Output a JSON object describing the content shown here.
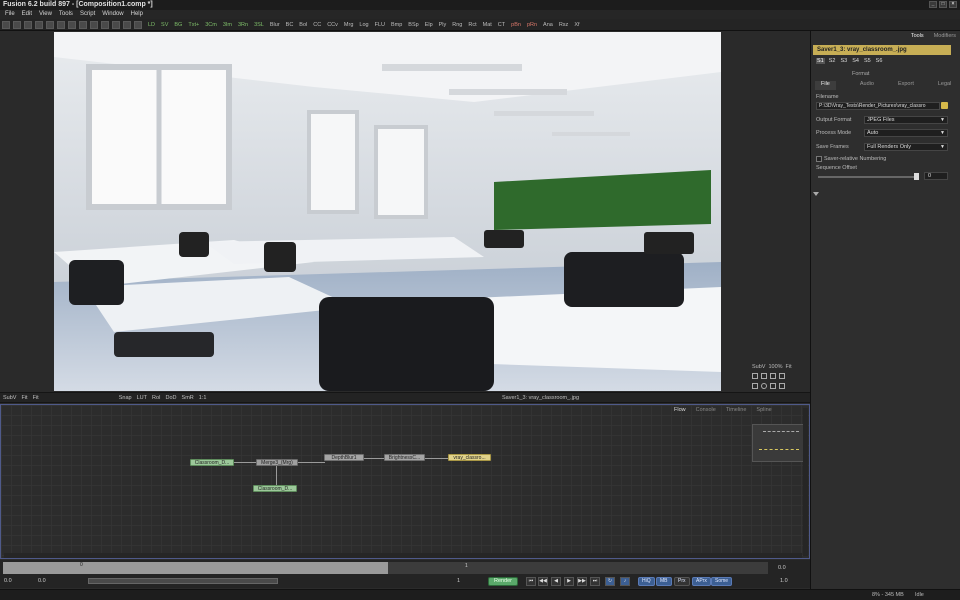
{
  "window": {
    "title": "Fusion 6.2 build 897 - [Composition1.comp *]"
  },
  "menu": [
    "File",
    "Edit",
    "View",
    "Tools",
    "Script",
    "Window",
    "Help"
  ],
  "toolbar": {
    "tools": [
      "LD",
      "SV",
      "BG",
      "Txt+",
      "3Cm",
      "3Im",
      "3Rn",
      "3SL",
      "Blur",
      "BC",
      "Bol",
      "CC",
      "CCv",
      "Mrg",
      "Log",
      "FLU",
      "Bmp",
      "BSp",
      "Elp",
      "Ply",
      "Rng",
      "Rct",
      "Mat",
      "CT",
      "pBn",
      "pRn",
      "Ana",
      "Rsz",
      "Xf"
    ]
  },
  "viewer": {
    "bar": [
      "SubV",
      "Fit",
      "Fit",
      "Snap",
      "LUT",
      "RoI",
      "DoD",
      "SmR",
      "1:1"
    ],
    "center_label": "Saver1_3: vray_classroom_.jpg",
    "right_tools": {
      "subv": "SubV",
      "zoom": "100%",
      "fit": "Fit"
    }
  },
  "flow": {
    "tabs": [
      "Flow",
      "Console",
      "Timeline",
      "Spline"
    ],
    "nodes": {
      "loader1": "Classroom_D...",
      "merge": "Merge3_(Mrg)",
      "loader2": "Classroom_D...",
      "blur": "DepthBlur1",
      "bc": "BrightnessC...",
      "saver": "vray_classro..."
    }
  },
  "timeline": {
    "start": "0.0",
    "current": "0.0",
    "zero": "0",
    "one": "1",
    "end_val": "1",
    "right_val": "0.0",
    "right_end": "1.0",
    "render_label": "Render",
    "buttons": {
      "hiq": "HiQ",
      "mb": "MB",
      "prx": "Prx",
      "aprx": "APrx",
      "some": "Some"
    }
  },
  "status": {
    "memory": "8% - 345 MB",
    "state": "Idle"
  },
  "inspector": {
    "tabs": [
      "Tools",
      "Modifiers"
    ],
    "header": "Saver1_3: vray_classroom_.jpg",
    "channels": [
      "S1",
      "S2",
      "S3",
      "S4",
      "S5",
      "S6"
    ],
    "format_label": "Format",
    "subtabs": [
      "File",
      "Audio",
      "Export",
      "Legal"
    ],
    "filename_label": "Filename",
    "filename_value": "P:\\3D\\Vray_Tests\\Render_Pictures\\vray_classro",
    "output_format": {
      "label": "Output Format",
      "value": "JPEG Files"
    },
    "process_mode": {
      "label": "Process Mode",
      "value": "Auto"
    },
    "save_frames": {
      "label": "Save Frames",
      "value": "Full Renders Only"
    },
    "relative_numbering": "Saver-relative Numbering",
    "sequence_offset": {
      "label": "Sequence Offset",
      "value": "0"
    }
  }
}
